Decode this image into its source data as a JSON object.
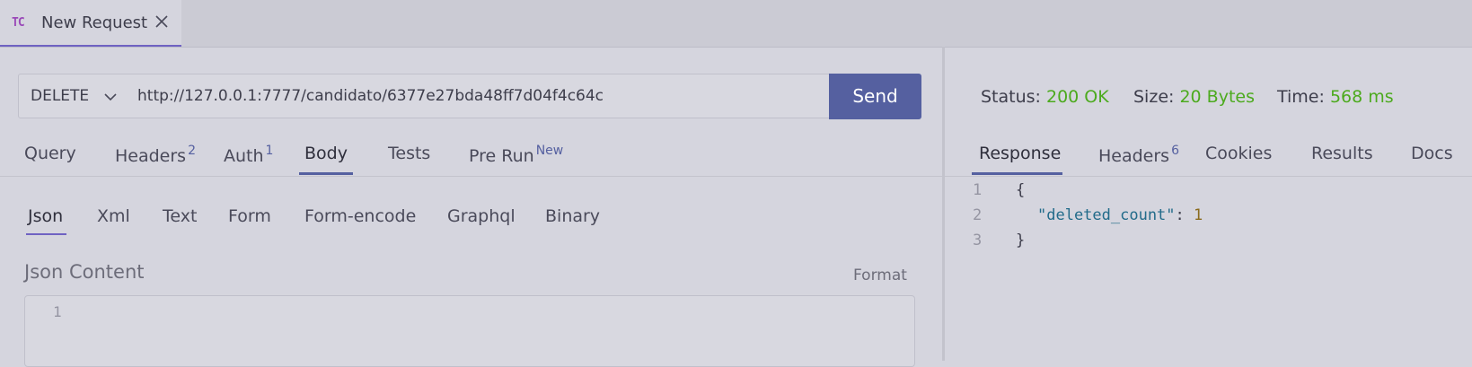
{
  "tab": {
    "badge": "TC",
    "title": "New Request"
  },
  "request": {
    "method": "DELETE",
    "url": "http://127.0.0.1:7777/candidato/6377e27bda48ff7d04f4c64c",
    "send_label": "Send"
  },
  "request_tabs": [
    {
      "label": "Query",
      "count": ""
    },
    {
      "label": "Headers",
      "count": "2"
    },
    {
      "label": "Auth",
      "count": "1"
    },
    {
      "label": "Body",
      "count": ""
    },
    {
      "label": "Tests",
      "count": ""
    },
    {
      "label": "Pre Run",
      "count": "New"
    }
  ],
  "active_request_tab": "Body",
  "body_tabs": [
    "Json",
    "Xml",
    "Text",
    "Form",
    "Form-encode",
    "Graphql",
    "Binary"
  ],
  "active_body_tab": "Json",
  "json_content": {
    "title": "Json Content",
    "format_label": "Format",
    "line_numbers": [
      "1"
    ]
  },
  "response_meta": {
    "status_key": "Status:",
    "status_value": "200 OK",
    "size_key": "Size:",
    "size_value": "20 Bytes",
    "time_key": "Time:",
    "time_value": "568 ms"
  },
  "response_tabs": [
    {
      "label": "Response",
      "count": ""
    },
    {
      "label": "Headers",
      "count": "6"
    },
    {
      "label": "Cookies",
      "count": ""
    },
    {
      "label": "Results",
      "count": ""
    },
    {
      "label": "Docs",
      "count": ""
    }
  ],
  "active_response_tab": "Response",
  "response_body": {
    "line_numbers": [
      "1",
      "2",
      "3"
    ],
    "open_brace": "{",
    "key": "\"deleted_count\"",
    "colon": ": ",
    "value": "1",
    "close_brace": "}"
  },
  "colors": {
    "accent": "#5560a0",
    "success": "#4caa1e",
    "background": "#d5d5de"
  }
}
